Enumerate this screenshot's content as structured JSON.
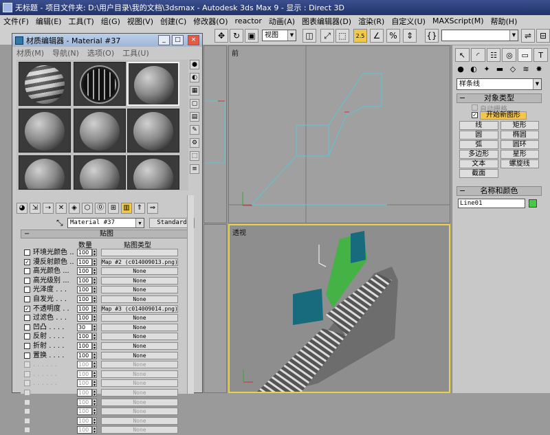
{
  "titlebar": {
    "text": "无标题   - 项目文件夹: D:\\用户目录\\我的文档\\3dsmax    - Autodesk 3ds Max 9    - 显示 : Direct 3D"
  },
  "menubar": {
    "items": [
      "文件(F)",
      "编辑(E)",
      "工具(T)",
      "组(G)",
      "视图(V)",
      "创建(C)",
      "修改器(O)",
      "reactor",
      "动画(A)",
      "图表编辑器(D)",
      "渲染(R)",
      "自定义(U)",
      "MAXScript(M)",
      "帮助(H)"
    ]
  },
  "toolbar": {
    "view_combo": "视图",
    "snap_label": "2.5"
  },
  "viewports": {
    "front_label": "前",
    "persp_label": "透视"
  },
  "command_panel": {
    "category_combo": "样条线",
    "object_type_title": "对象类型",
    "auto_grid": "自动栅格",
    "start_new_shape": "开始新图形",
    "buttons": [
      [
        "线",
        "矩形"
      ],
      [
        "圆",
        "椭圆"
      ],
      [
        "弧",
        "圆环"
      ],
      [
        "多边形",
        "星形"
      ],
      [
        "文本",
        "螺旋线"
      ],
      [
        "截面",
        ""
      ]
    ],
    "name_color_title": "名称和颜色",
    "object_name": "Line01",
    "object_color": "#44cc44"
  },
  "material_editor": {
    "title": "材质编辑器 - Material #37",
    "menus": [
      "材质(M)",
      "导航(N)",
      "选项(O)",
      "工具(U)"
    ],
    "material_name": "Material #37",
    "material_type": "Standard",
    "maps_title": "贴图",
    "col_amount": "数量",
    "col_map_type": "贴图类型",
    "rows": [
      {
        "name": "环境光颜色",
        "dots": "..",
        "checked": false,
        "amount": "100",
        "map": "",
        "enabled": true
      },
      {
        "name": "漫反射颜色",
        "dots": "..",
        "checked": true,
        "amount": "100",
        "map": "Map #2 (c014009013.png)",
        "enabled": true
      },
      {
        "name": "高光颜色",
        "dots": "...",
        "checked": false,
        "amount": "100",
        "map": "None",
        "enabled": true
      },
      {
        "name": "高光级别",
        "dots": "...",
        "checked": false,
        "amount": "100",
        "map": "None",
        "enabled": true
      },
      {
        "name": "光泽度",
        "dots": ". . .",
        "checked": false,
        "amount": "100",
        "map": "None",
        "enabled": true
      },
      {
        "name": "自发光",
        "dots": ". . .",
        "checked": false,
        "amount": "100",
        "map": "None",
        "enabled": true
      },
      {
        "name": "不透明度",
        "dots": ". .",
        "checked": true,
        "amount": "100",
        "map": "Map #3 (c014009014.png)",
        "enabled": true
      },
      {
        "name": "过滤色",
        "dots": ". . .",
        "checked": false,
        "amount": "100",
        "map": "None",
        "enabled": true
      },
      {
        "name": "凹凸",
        "dots": ". . . .",
        "checked": false,
        "amount": "30",
        "map": "None",
        "enabled": true
      },
      {
        "name": "反射",
        "dots": ". . . .",
        "checked": false,
        "amount": "100",
        "map": "None",
        "enabled": true
      },
      {
        "name": "折射",
        "dots": ". . . .",
        "checked": false,
        "amount": "100",
        "map": "None",
        "enabled": true
      },
      {
        "name": "置换",
        "dots": ". . . .",
        "checked": false,
        "amount": "100",
        "map": "None",
        "enabled": true
      },
      {
        "name": "",
        "dots": ". . . . . .",
        "checked": false,
        "amount": "100",
        "map": "None",
        "enabled": false
      },
      {
        "name": "",
        "dots": ". . . . . .",
        "checked": false,
        "amount": "100",
        "map": "None",
        "enabled": false
      },
      {
        "name": "",
        "dots": ". . . . . .",
        "checked": false,
        "amount": "100",
        "map": "None",
        "enabled": false
      },
      {
        "name": "",
        "dots": ". . . . . .",
        "checked": false,
        "amount": "100",
        "map": "None",
        "enabled": false
      },
      {
        "name": "",
        "dots": ". . . . . .",
        "checked": false,
        "amount": "100",
        "map": "None",
        "enabled": false
      },
      {
        "name": "",
        "dots": ". . . . . .",
        "checked": false,
        "amount": "100",
        "map": "None",
        "enabled": false
      },
      {
        "name": "",
        "dots": ". . . . . .",
        "checked": false,
        "amount": "100",
        "map": "None",
        "enabled": false
      },
      {
        "name": "",
        "dots": ". . . . . .",
        "checked": false,
        "amount": "100",
        "map": "None",
        "enabled": false
      }
    ]
  },
  "colors": {
    "selection_yellow": "#e8d24a",
    "shape_cyan": "#5ec6d6",
    "panel_gray": "#c8c8c8"
  }
}
